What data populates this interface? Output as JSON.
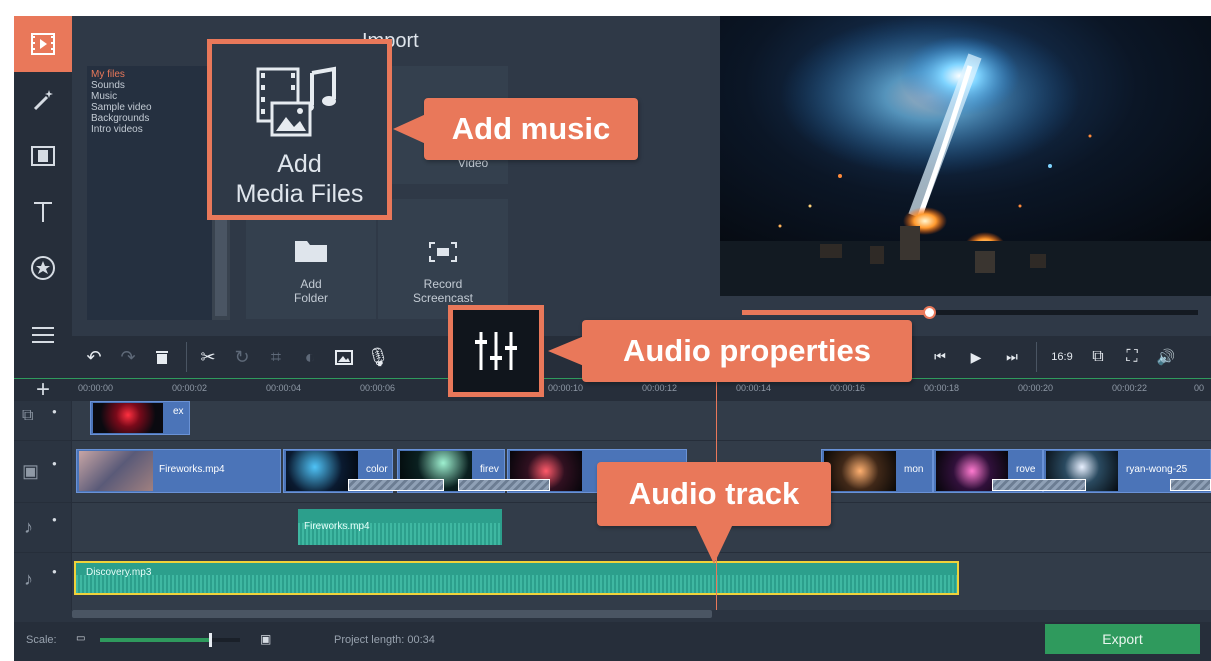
{
  "import": {
    "title": "Import",
    "categories": [
      "My files",
      "Sounds",
      "Music",
      "Sample video",
      "Backgrounds",
      "Intro videos"
    ],
    "add_media_label_1": "Add",
    "add_media_label_2": "Media Files",
    "record_video_label": "Record Video",
    "add_folder_label_1": "Add",
    "add_folder_label_2": "Folder",
    "record_screencast_label_1": "Record",
    "record_screencast_label_2": "Screencast"
  },
  "preview": {
    "progress": 0.41
  },
  "toolbar": {
    "aspect_label": "16:9"
  },
  "ruler": {
    "ticks": [
      "00:00:00",
      "00:00:02",
      "00:00:04",
      "00:00:06",
      "00:00:10",
      "00:00:12",
      "00:00:14",
      "00:00:16",
      "00:00:18",
      "00:00:20",
      "00:00:22",
      "00"
    ]
  },
  "tracks": {
    "overlay_clip": "ex",
    "video_clips": [
      "Fireworks.mp4",
      "color",
      "firev",
      "",
      "mon",
      "rove",
      "ryan-wong-25"
    ],
    "linked_audio": "Fireworks.mp4",
    "music_clip": "Discovery.mp3"
  },
  "bottom": {
    "scale_label": "Scale:",
    "scale_level": 0.78,
    "project_length": "Project length:  00:34",
    "export_label": "Export"
  },
  "callouts": {
    "add_music": "Add music",
    "audio_properties": "Audio properties",
    "audio_track": "Audio track"
  },
  "colors": {
    "accent": "#e9785a",
    "green": "#2f9a5d",
    "video_clip": "#4b74b8",
    "audio_clip": "#2c9f8c"
  }
}
